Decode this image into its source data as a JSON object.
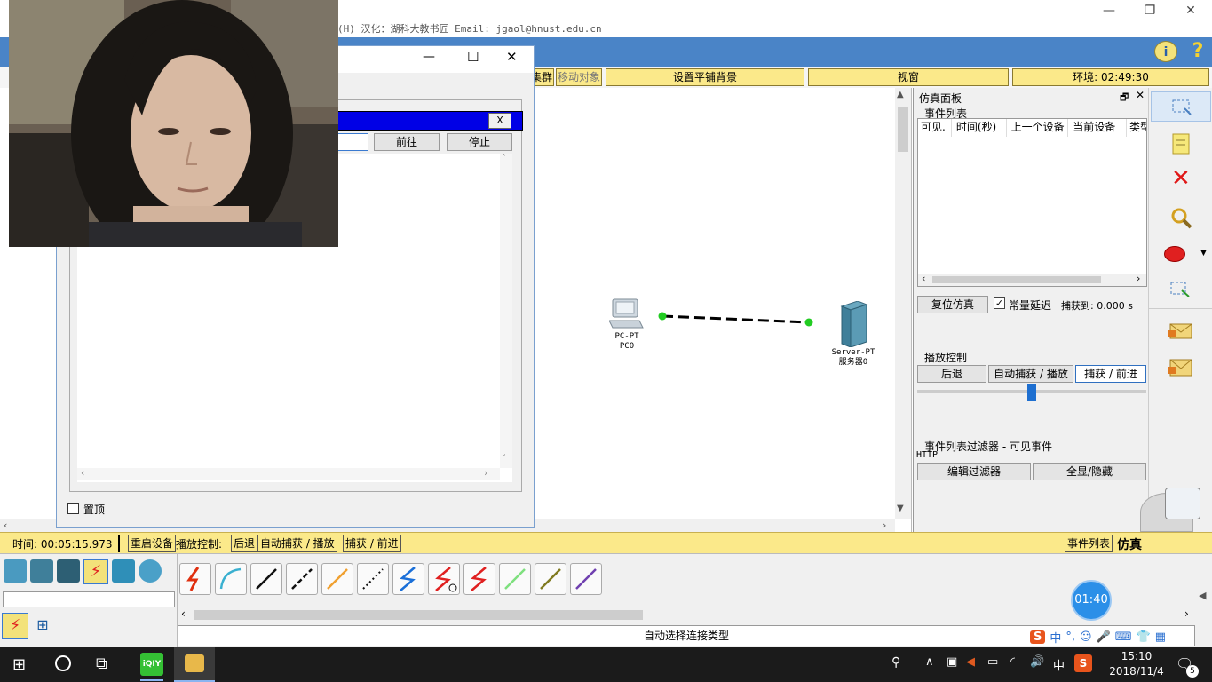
{
  "title_bar": {
    "text": "(H)  汉化：湖科大教书匠  Email: jgaol@hnust.edu.cn",
    "minimize": "—",
    "restore": "❐",
    "close": "✕"
  },
  "app_toolbar": {
    "info_icon": "info-icon",
    "help_label": "?"
  },
  "top_bar": {
    "cluster_label": "集群",
    "move_label": "移动对象",
    "bg_label": "设置平铺背景",
    "viewport_label": "视窗",
    "env_label": "环境: 02:49:30"
  },
  "dialog": {
    "minimize": "—",
    "maximize": "☐",
    "close": "✕",
    "url_close": "X",
    "go_label": "前往",
    "stop_label": "停止",
    "topmost_label": "置顶"
  },
  "topology": {
    "pc_type": "PC-PT",
    "pc_name": "PC0",
    "server_type": "Server-PT",
    "server_name": "服务器0"
  },
  "sim_panel": {
    "title": "仿真面板",
    "event_list_label": "事件列表",
    "columns": [
      "可见.",
      "时间(秒)",
      "上一个设备",
      "当前设备",
      "类型"
    ],
    "reset_label": "复位仿真",
    "constant_delay_label": "常量延迟",
    "constant_delay_checked": true,
    "captured_label": "捕获到: 0.000 s",
    "playback_label": "播放控制",
    "back_label": "后退",
    "auto_label": "自动捕获 / 播放",
    "forward_label": "捕获 / 前进",
    "filter_label": "事件列表过滤器 - 可见事件",
    "filter_value": "HTTP",
    "edit_filter_label": "编辑过滤器",
    "show_all_label": "全显/隐藏"
  },
  "status_bar": {
    "time_label": "时间: 00:05:15.973",
    "restart_label": "重启设备",
    "play_control_label": "播放控制:",
    "back_label": "后退",
    "auto_label": "自动捕获 / 播放",
    "forward_label": "捕获 / 前进",
    "event_list_label": "事件列表",
    "sim_label": "仿真"
  },
  "device_bar": {
    "hint": "自动选择连接类型",
    "timer_badge": "01:40"
  },
  "ime": {
    "lang": "中",
    "punct": "°,"
  },
  "taskbar": {
    "tray_lang": "中",
    "time": "15:10",
    "date": "2018/11/4",
    "notif_count": "5"
  },
  "colors": {
    "app_blue": "#4a84c7",
    "yellow": "#fbe98a",
    "url_bar_blue": "#0000e6",
    "link_dot": "#22cc22"
  }
}
